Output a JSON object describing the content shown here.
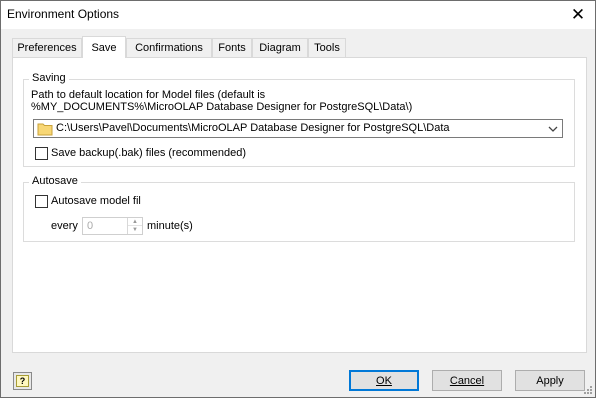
{
  "window": {
    "title": "Environment Options",
    "close_glyph": "✕"
  },
  "tabs": [
    {
      "label": "Preferences",
      "active": false
    },
    {
      "label": "Save",
      "active": true
    },
    {
      "label": "Confirmations",
      "active": false
    },
    {
      "label": "Fonts",
      "active": false
    },
    {
      "label": "Diagram",
      "active": false
    },
    {
      "label": "Tools",
      "active": false
    }
  ],
  "saving": {
    "group_title": "Saving",
    "path_label_line1": "Path to default location for Model files (default is",
    "path_label_line2": "%MY_DOCUMENTS%\\MicroOLAP Database Designer for PostgreSQL\\Data\\)",
    "path_value": "C:\\Users\\Pavel\\Documents\\MicroOLAP Database Designer for PostgreSQL\\Data",
    "backup_label": "Save backup(.bak) files (recommended)",
    "backup_checked": false
  },
  "autosave": {
    "group_title": "Autosave",
    "autosave_label": "Autosave model fil",
    "autosave_checked": false,
    "every_label": "every",
    "minutes_value": "0",
    "minutes_label": "minute(s)"
  },
  "buttons": {
    "help_glyph": "?",
    "ok_label": "OK",
    "cancel_label": "Cancel",
    "apply_label": "Apply"
  },
  "icons": {
    "folder": "folder-icon",
    "dropdown": "chevron-down-icon",
    "help": "help-icon",
    "close": "close-icon"
  },
  "colors": {
    "window_bg": "#f0f0f0",
    "panel_bg": "#ffffff",
    "default_button_border": "#0078d7",
    "folder_yellow": "#f8d775"
  }
}
